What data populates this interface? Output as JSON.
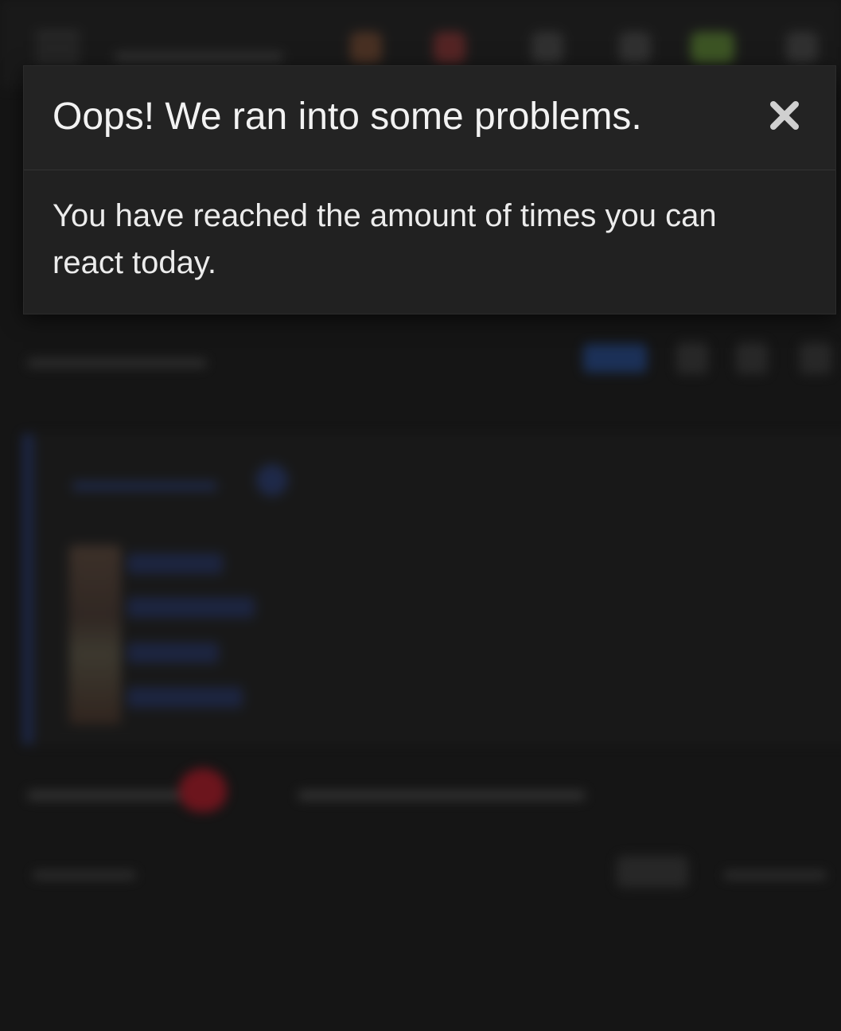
{
  "dialog": {
    "title": "Oops! We ran into some problems.",
    "message": "You have reached the amount of times you can react today.",
    "close_icon": "close-icon"
  },
  "colors": {
    "page_background": "#151515",
    "dialog_background": "#212121",
    "text": "#f2f2f2",
    "quote_accent": "#1f2c55",
    "heart": "#8a1520"
  }
}
